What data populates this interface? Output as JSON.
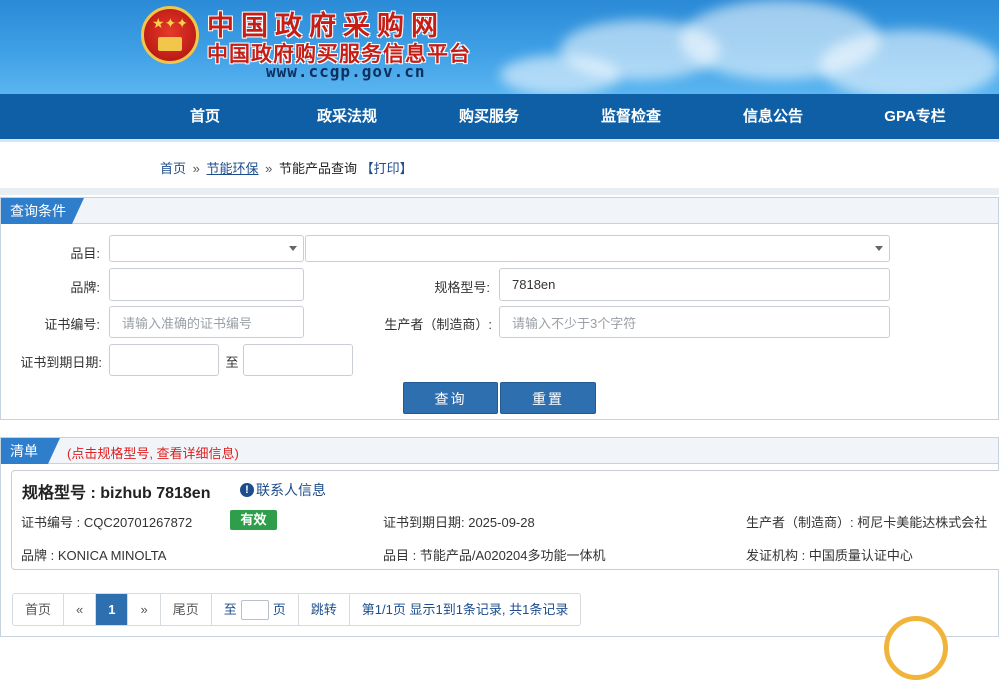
{
  "header": {
    "title_cn": "中国政府采购网",
    "subtitle_cn": "中国政府购买服务信息平台",
    "url": "www.ccgp.gov.cn"
  },
  "nav": {
    "items": [
      "首页",
      "政采法规",
      "购买服务",
      "监督检查",
      "信息公告",
      "GPA专栏"
    ]
  },
  "breadcrumb": {
    "home": "首页",
    "sep": "»",
    "section": "节能环保",
    "page": "节能产品查询",
    "print": "【打印】"
  },
  "query_panel": {
    "tab_label": "查询条件",
    "category_label": "品目:",
    "brand_label": "品牌:",
    "brand_value": "",
    "model_label": "规格型号:",
    "model_value": "7818en",
    "cert_label": "证书编号:",
    "cert_placeholder": "请输入准确的证书编号",
    "maker_label": "生产者（制造商）:",
    "maker_placeholder": "请输入不少于3个字符",
    "expiry_label": "证书到期日期:",
    "expiry_to": "至",
    "search_button": "查询",
    "reset_button": "重置"
  },
  "list_panel": {
    "tab_label": "清单",
    "hint": "(点击规格型号, 查看详细信息)"
  },
  "result": {
    "title": "规格型号 : bizhub 7818en",
    "contact_link": "联系人信息",
    "cert_no": "证书编号 : CQC20701267872",
    "status": "有效",
    "expiry": "证书到期日期: 2025-09-28",
    "maker": "生产者（制造商）: 柯尼卡美能达株式会社",
    "brand": "品牌 : KONICA MINOLTA",
    "category": "品目 : 节能产品/A020204多功能一体机",
    "issuer": "发证机构 : 中国质量认证中心"
  },
  "pagination": {
    "first": "首页",
    "prev": "«",
    "current": "1",
    "next": "»",
    "last": "尾页",
    "goto_prefix": "至",
    "goto_suffix": "页",
    "jump": "跳转",
    "summary": "第1/1页  显示1到1条记录, 共1条记录"
  },
  "colors": {
    "nav_bg": "#0f5fa6",
    "accent": "#2e6faf",
    "valid_badge": "#2e9e4a",
    "hint_red": "#e02020"
  }
}
